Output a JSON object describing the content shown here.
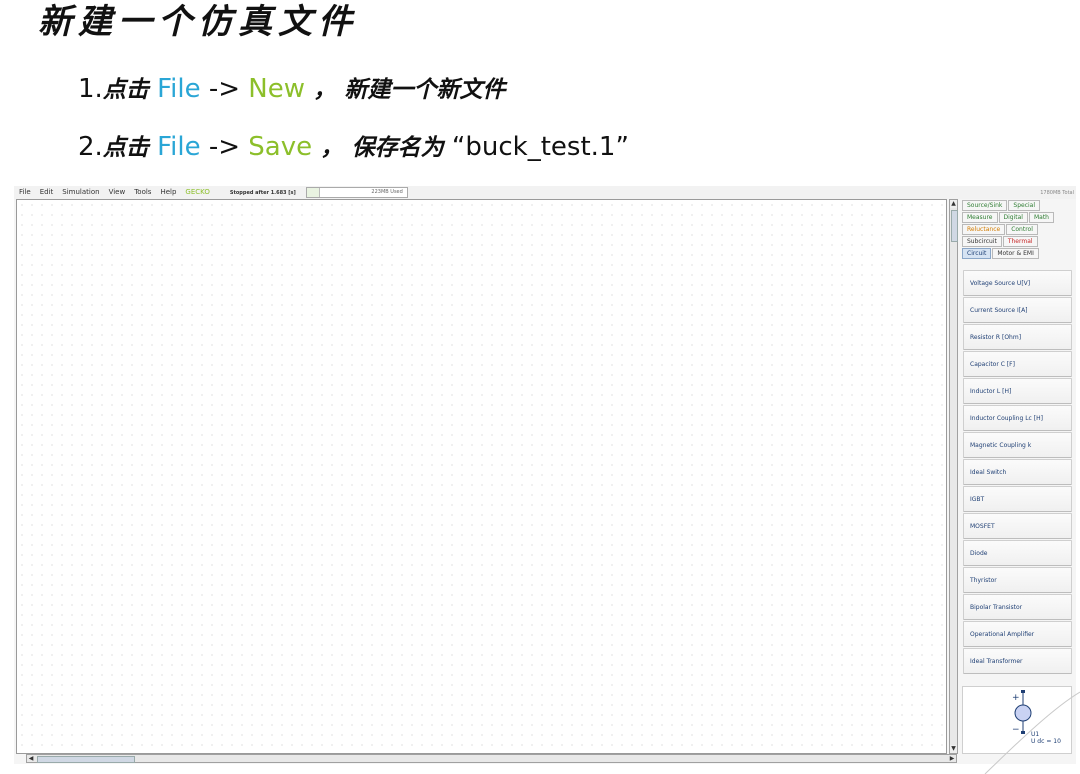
{
  "slide": {
    "title": "新建一个仿真文件",
    "step1": {
      "num": "1.",
      "action": "点击",
      "menu": "File",
      "arrow": "->",
      "item": "New",
      "comma": "，",
      "desc": "新建一个新文件"
    },
    "step2": {
      "num": "2.",
      "action": "点击",
      "menu": "File",
      "arrow": "->",
      "item": "Save",
      "comma": "，",
      "desc": "保存名为",
      "filename": "“buck_test.1”"
    }
  },
  "app": {
    "menu": [
      "File",
      "Edit",
      "Simulation",
      "View",
      "Tools",
      "Help",
      "GECKO"
    ],
    "status": "Stopped after 1.683 [s]",
    "memory_used": "223MB Used",
    "memory_fraction": 0.12,
    "memory_total": "1780MB Total"
  },
  "panel": {
    "tab_rows": [
      [
        {
          "label": "Source/Sink",
          "color": "green"
        },
        {
          "label": "Special",
          "color": "green"
        }
      ],
      [
        {
          "label": "Measure",
          "color": "green"
        },
        {
          "label": "Digital",
          "color": "green"
        },
        {
          "label": "Math",
          "color": "green"
        }
      ],
      [
        {
          "label": "Reluctance",
          "color": "orange"
        },
        {
          "label": "Control",
          "color": "green"
        }
      ],
      [
        {
          "label": "Subcircuit",
          "color": "black"
        },
        {
          "label": "Thermal",
          "color": "red"
        }
      ],
      [
        {
          "label": "Circuit",
          "color": "active"
        },
        {
          "label": "Motor & EMI",
          "color": "black"
        }
      ]
    ],
    "components": [
      "Voltage Source U[V]",
      "Current Source I[A]",
      "Resistor R [Ohm]",
      "Capacitor C [F]",
      "Inductor L [H]",
      "Inductor Coupling Lc [H]",
      "Magnetic Coupling k",
      "Ideal Switch",
      "IGBT",
      "MOSFET",
      "Diode",
      "Thyristor",
      "Bipolar Transistor",
      "Operational Amplifier",
      "Ideal Transformer"
    ],
    "preview": {
      "plus": "+",
      "minus": "−",
      "name": "U1",
      "value": "U dc = 10"
    }
  },
  "colors": {
    "file": "#2aa6d6",
    "menu_item": "#8cbf2a",
    "component_text": "#1f3f74"
  }
}
